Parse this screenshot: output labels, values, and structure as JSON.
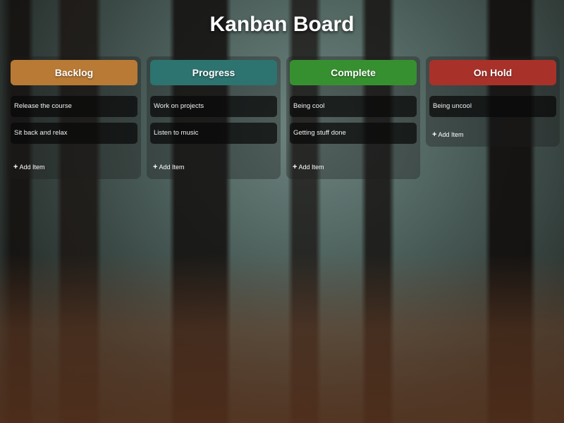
{
  "page": {
    "title": "Kanban Board"
  },
  "columns": [
    {
      "title": "Backlog",
      "color": "#b87a34",
      "items": [
        "Release the course",
        "Sit back and relax"
      ],
      "add_label": "Add Item"
    },
    {
      "title": "Progress",
      "color": "#2d7370",
      "items": [
        "Work on projects",
        "Listen to music"
      ],
      "add_label": "Add Item"
    },
    {
      "title": "Complete",
      "color": "#37902f",
      "items": [
        "Being cool",
        "Getting stuff done"
      ],
      "add_label": "Add Item"
    },
    {
      "title": "On Hold",
      "color": "#a8322a",
      "items": [
        "Being uncool"
      ],
      "add_label": "Add Item"
    }
  ],
  "icons": {
    "add": "plus-icon"
  }
}
